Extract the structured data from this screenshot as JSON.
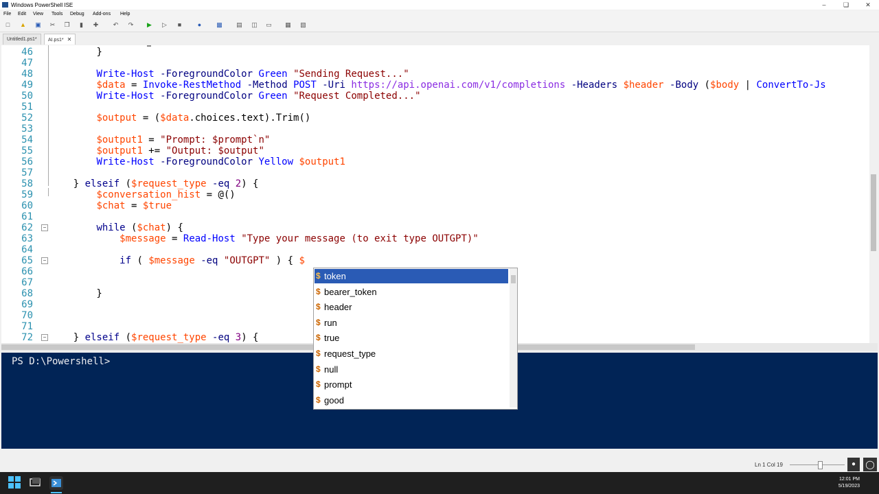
{
  "window": {
    "title": "Windows PowerShell ISE"
  },
  "menu": [
    "File",
    "Edit",
    "View",
    "Tools",
    "Debug",
    "Add-ons",
    "Help"
  ],
  "tabs": [
    {
      "label": "Untitled1.ps1*",
      "active": false
    },
    {
      "label": "AI.ps1*",
      "active": true
    }
  ],
  "editor": {
    "lines": [
      {
        "n": "46",
        "tokens": [
          [
            "",
            "        "
          ],
          [
            "",
            "}"
          ]
        ]
      },
      {
        "n": "47",
        "tokens": []
      },
      {
        "n": "48",
        "tokens": [
          [
            "",
            "        "
          ],
          [
            "cmd",
            "Write-Host"
          ],
          [
            "",
            " "
          ],
          [
            "par",
            "-ForegroundColor"
          ],
          [
            "",
            " "
          ],
          [
            "cmd",
            "Green"
          ],
          [
            "",
            " "
          ],
          [
            "str",
            "\"Sending Request...\""
          ]
        ]
      },
      {
        "n": "49",
        "tokens": [
          [
            "",
            "        "
          ],
          [
            "var",
            "$data"
          ],
          [
            "",
            " = "
          ],
          [
            "cmd",
            "Invoke-RestMethod"
          ],
          [
            "",
            " "
          ],
          [
            "par",
            "-Method"
          ],
          [
            "",
            " "
          ],
          [
            "cmd",
            "POST"
          ],
          [
            "",
            " "
          ],
          [
            "par",
            "-Uri"
          ],
          [
            "",
            " "
          ],
          [
            "url",
            "https://api.openai.com/v1/completions"
          ],
          [
            "",
            " "
          ],
          [
            "par",
            "-Headers"
          ],
          [
            "",
            " "
          ],
          [
            "var",
            "$header"
          ],
          [
            "",
            " "
          ],
          [
            "par",
            "-Body"
          ],
          [
            "",
            " ("
          ],
          [
            "var",
            "$body"
          ],
          [
            "",
            " | "
          ],
          [
            "cmd",
            "ConvertTo-Js"
          ]
        ]
      },
      {
        "n": "50",
        "tokens": [
          [
            "",
            "        "
          ],
          [
            "cmd",
            "Write-Host"
          ],
          [
            "",
            " "
          ],
          [
            "par",
            "-ForegroundColor"
          ],
          [
            "",
            " "
          ],
          [
            "cmd",
            "Green"
          ],
          [
            "",
            " "
          ],
          [
            "str",
            "\"Request Completed...\""
          ]
        ]
      },
      {
        "n": "51",
        "tokens": []
      },
      {
        "n": "52",
        "tokens": [
          [
            "",
            "        "
          ],
          [
            "var",
            "$output"
          ],
          [
            "",
            " = ("
          ],
          [
            "var",
            "$data"
          ],
          [
            "mem",
            ".choices.text"
          ],
          [
            "",
            ")."
          ],
          [
            "mem",
            "Trim"
          ],
          [
            "",
            "()"
          ]
        ]
      },
      {
        "n": "53",
        "tokens": []
      },
      {
        "n": "54",
        "tokens": [
          [
            "",
            "        "
          ],
          [
            "var",
            "$output1"
          ],
          [
            "",
            " = "
          ],
          [
            "str",
            "\"Prompt: $prompt`n\""
          ]
        ]
      },
      {
        "n": "55",
        "tokens": [
          [
            "",
            "        "
          ],
          [
            "var",
            "$output1"
          ],
          [
            "",
            " += "
          ],
          [
            "str",
            "\"Output: $output\""
          ]
        ]
      },
      {
        "n": "56",
        "tokens": [
          [
            "",
            "        "
          ],
          [
            "cmd",
            "Write-Host"
          ],
          [
            "",
            " "
          ],
          [
            "par",
            "-ForegroundColor"
          ],
          [
            "",
            " "
          ],
          [
            "cmd",
            "Yellow"
          ],
          [
            "",
            " "
          ],
          [
            "var",
            "$output1"
          ]
        ]
      },
      {
        "n": "57",
        "tokens": []
      },
      {
        "n": "58",
        "tokens": [
          [
            "",
            "    } "
          ],
          [
            "kw",
            "elseif"
          ],
          [
            "",
            " ("
          ],
          [
            "var",
            "$request_type"
          ],
          [
            "",
            " "
          ],
          [
            "par",
            "-eq"
          ],
          [
            "",
            " "
          ],
          [
            "num",
            "2"
          ],
          [
            "",
            ") {"
          ]
        ]
      },
      {
        "n": "59",
        "tokens": [
          [
            "",
            "        "
          ],
          [
            "var",
            "$conversation_hist"
          ],
          [
            "",
            " = @()"
          ]
        ]
      },
      {
        "n": "60",
        "tokens": [
          [
            "",
            "        "
          ],
          [
            "var",
            "$chat"
          ],
          [
            "",
            " = "
          ],
          [
            "var",
            "$true"
          ]
        ]
      },
      {
        "n": "61",
        "tokens": []
      },
      {
        "n": "62",
        "tokens": [
          [
            "",
            "        "
          ],
          [
            "kw",
            "while"
          ],
          [
            "",
            " ("
          ],
          [
            "var",
            "$chat"
          ],
          [
            "",
            ") {"
          ]
        ]
      },
      {
        "n": "63",
        "tokens": [
          [
            "",
            "            "
          ],
          [
            "var",
            "$message"
          ],
          [
            "",
            " = "
          ],
          [
            "cmd",
            "Read-Host"
          ],
          [
            "",
            " "
          ],
          [
            "str",
            "\"Type your message (to exit type OUTGPT)\""
          ]
        ]
      },
      {
        "n": "64",
        "tokens": []
      },
      {
        "n": "65",
        "tokens": [
          [
            "",
            "            "
          ],
          [
            "kw",
            "if"
          ],
          [
            "",
            " ( "
          ],
          [
            "var",
            "$message"
          ],
          [
            "",
            " "
          ],
          [
            "par",
            "-eq"
          ],
          [
            "",
            " "
          ],
          [
            "str",
            "\"OUTGPT\""
          ],
          [
            "",
            " ) { "
          ],
          [
            "var",
            "$"
          ]
        ]
      },
      {
        "n": "66",
        "tokens": []
      },
      {
        "n": "67",
        "tokens": []
      },
      {
        "n": "68",
        "tokens": [
          [
            "",
            "        }"
          ]
        ]
      },
      {
        "n": "69",
        "tokens": []
      },
      {
        "n": "70",
        "tokens": []
      },
      {
        "n": "71",
        "tokens": []
      },
      {
        "n": "72",
        "tokens": [
          [
            "",
            "    } "
          ],
          [
            "kw",
            "elseif"
          ],
          [
            "",
            " ("
          ],
          [
            "var",
            "$request_type"
          ],
          [
            "",
            " "
          ],
          [
            "par",
            "-eq"
          ],
          [
            "",
            " "
          ],
          [
            "num",
            "3"
          ],
          [
            "",
            ") {"
          ]
        ]
      }
    ]
  },
  "console": {
    "prompt": "PS D:\\Powershell>"
  },
  "autocomplete": {
    "items": [
      "token",
      "bearer_token",
      "header",
      "run",
      "true",
      "request_type",
      "null",
      "prompt",
      "good"
    ],
    "selected_index": 0
  },
  "status": {
    "position": "Ln 1  Col 19"
  },
  "taskbar": {
    "time": "12:01 PM",
    "date": "5/19/2023"
  },
  "colors": {
    "console_bg": "#012456",
    "selection": "#2a5bb5"
  }
}
